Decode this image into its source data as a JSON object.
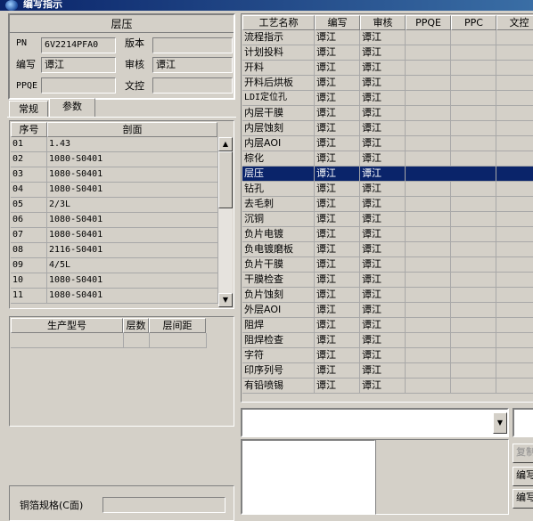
{
  "window": {
    "title": "编写指示"
  },
  "left_panel": {
    "header": "层压",
    "pn_label": "PN",
    "pn_value": "6V2214PFA0",
    "version_label": "版本",
    "version_value": "",
    "writer_label": "编写",
    "writer_value": "谭江",
    "reviewer_label": "审核",
    "reviewer_value": "谭江",
    "ppqe_label": "PPQE",
    "ppqe_value": "",
    "doc_control_label": "文控",
    "doc_control_value": ""
  },
  "tabs": [
    {
      "label": "常规",
      "active": false
    },
    {
      "label": "参数",
      "active": true
    }
  ],
  "section_table": {
    "columns": [
      "序号",
      "剖面"
    ],
    "rows": [
      [
        "01",
        "1.43"
      ],
      [
        "02",
        "1080-S0401"
      ],
      [
        "03",
        "1080-S0401"
      ],
      [
        "04",
        "1080-S0401"
      ],
      [
        "05",
        "2/3L"
      ],
      [
        "06",
        "1080-S0401"
      ],
      [
        "07",
        "1080-S0401"
      ],
      [
        "08",
        "2116-S0401"
      ],
      [
        "09",
        "4/5L"
      ],
      [
        "10",
        "1080-S0401"
      ],
      [
        "11",
        "1080-S0401"
      ]
    ]
  },
  "production_table": {
    "columns": [
      "生产型号",
      "层数",
      "层间距"
    ]
  },
  "bottom_left": {
    "label": "铜箔规格(C面)"
  },
  "process_table": {
    "columns": [
      "工艺名称",
      "编写",
      "审核",
      "PPQE",
      "PPC",
      "文控"
    ],
    "selected_index": 10,
    "rows": [
      [
        "流程指示",
        "谭江",
        "谭江"
      ],
      [
        "计划投料",
        "谭江",
        "谭江"
      ],
      [
        "开料",
        "谭江",
        "谭江"
      ],
      [
        "开料后烘板",
        "谭江",
        "谭江"
      ],
      [
        "LDI定位孔",
        "谭江",
        "谭江"
      ],
      [
        "内层干膜",
        "谭江",
        "谭江"
      ],
      [
        "内层蚀刻",
        "谭江",
        "谭江"
      ],
      [
        "内层AOI",
        "谭江",
        "谭江"
      ],
      [
        "棕化",
        "谭江",
        "谭江"
      ],
      [
        "层压",
        "谭江",
        "谭江"
      ],
      [
        "钻孔",
        "谭江",
        "谭江"
      ],
      [
        "去毛刺",
        "谭江",
        "谭江"
      ],
      [
        "沉铜",
        "谭江",
        "谭江"
      ],
      [
        "负片电镀",
        "谭江",
        "谭江"
      ],
      [
        "负电镀磨板",
        "谭江",
        "谭江"
      ],
      [
        "负片干膜",
        "谭江",
        "谭江"
      ],
      [
        "干膜检查",
        "谭江",
        "谭江"
      ],
      [
        "负片蚀刻",
        "谭江",
        "谭江"
      ],
      [
        "外层AOI",
        "谭江",
        "谭江"
      ],
      [
        "阻焊",
        "谭江",
        "谭江"
      ],
      [
        "阻焊检查",
        "谭江",
        "谭江"
      ],
      [
        "字符",
        "谭江",
        "谭江"
      ],
      [
        "印序列号",
        "谭江",
        "谭江"
      ],
      [
        "有铅喷锡",
        "谭江",
        "谭江"
      ]
    ]
  },
  "right_buttons": {
    "copy": "复制",
    "write1": "编写",
    "write2": "编写"
  },
  "colors": {
    "selection": "#0a246a",
    "face": "#d4d0c8",
    "title_start": "#0a246a"
  }
}
